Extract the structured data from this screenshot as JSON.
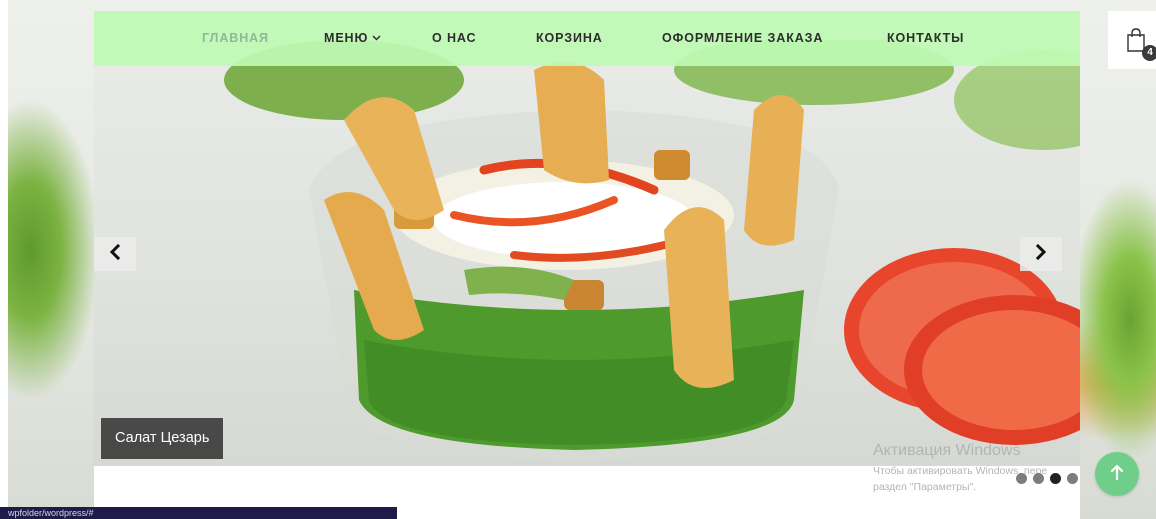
{
  "nav": {
    "items": [
      {
        "label": "ГЛАВНАЯ",
        "active": true
      },
      {
        "label": "МЕНЮ",
        "has_dropdown": true
      },
      {
        "label": "О НАС"
      },
      {
        "label": "КОРЗИНА"
      },
      {
        "label": "ОФОРМЛЕНИЕ ЗАКАЗА"
      },
      {
        "label": "КОНТАКТЫ"
      }
    ],
    "dropdown_icon": "chevron-down-icon",
    "active_color": "#8bb99a",
    "background_color": "#befab4"
  },
  "cart": {
    "icon": "shopping-bag-icon",
    "count": "4"
  },
  "slider": {
    "caption": "Салат Цезарь",
    "prev_icon": "chevron-left-icon",
    "next_icon": "chevron-right-icon",
    "dots": 4,
    "active_dot": 3
  },
  "watermark": {
    "title": "Активация Windows",
    "line1": "Чтобы активировать Windows, пере",
    "line2": "раздел \"Параметры\"."
  },
  "back_to_top": {
    "icon": "arrow-up-icon",
    "color": "#6fcf8a"
  },
  "status_bar": {
    "url": "wpfolder/wordpress/#"
  }
}
